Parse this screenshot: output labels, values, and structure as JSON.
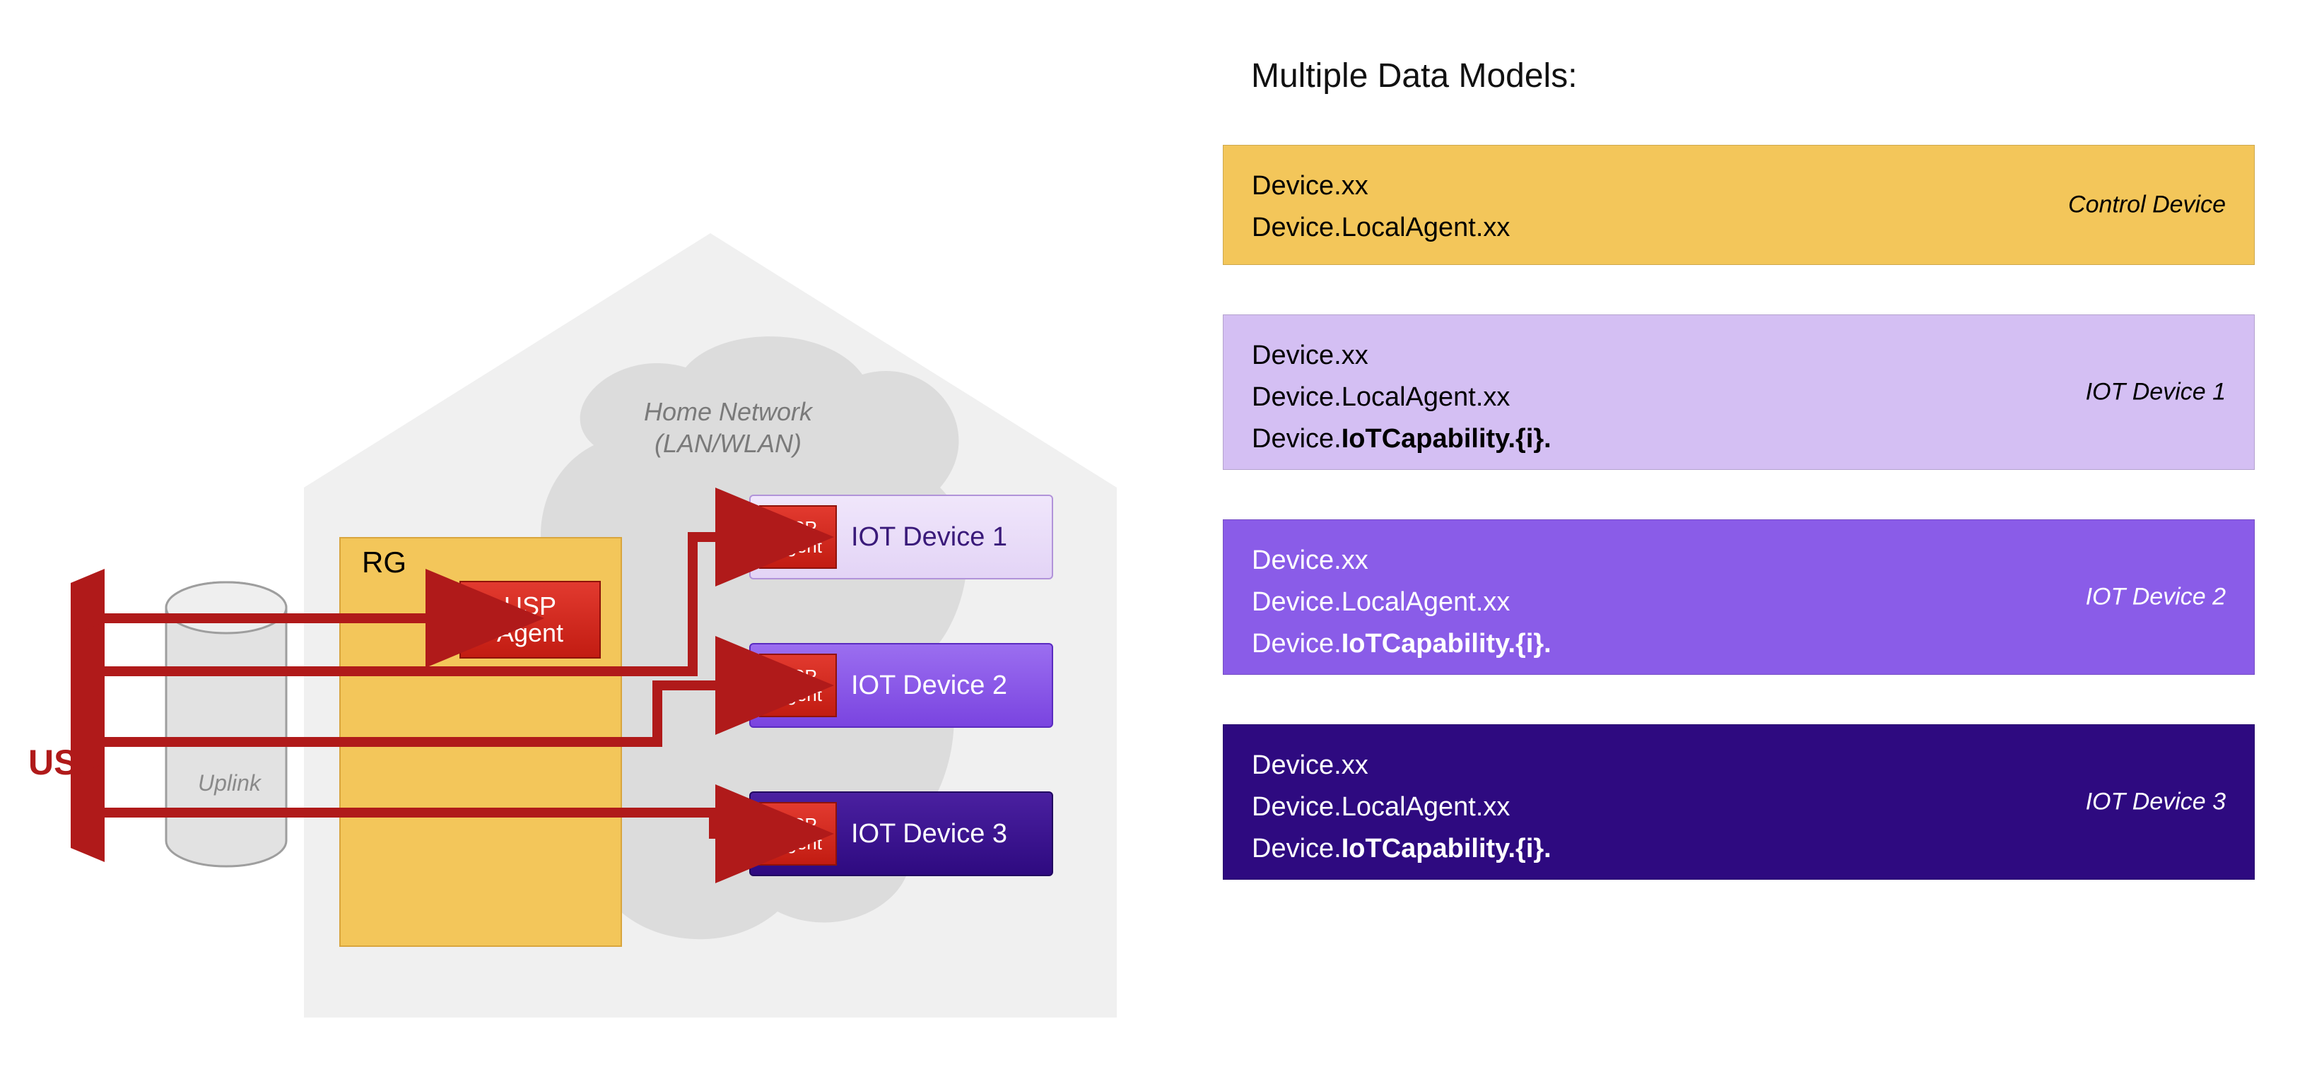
{
  "title": "Multiple Data Models:",
  "left": {
    "house_fill": "#f0f0f0",
    "cloud_fill": "#dcdcdc",
    "cloud_label_line1": "Home Network",
    "cloud_label_line2": "(LAN/WLAN)",
    "rg_label": "RG",
    "usp_agent_line1": "USP",
    "usp_agent_line2": "Agent",
    "uplink_label": "Uplink",
    "usp_label": "USP",
    "arrow_color": "#b01a1a",
    "iot_devices": [
      {
        "label": "IOT Device 1"
      },
      {
        "label": "IOT Device 2"
      },
      {
        "label": "IOT Device 3"
      }
    ]
  },
  "right": {
    "panels": [
      {
        "tag": "Control Device",
        "class": "dm-control",
        "lines": [
          {
            "prefix": "Device.xx",
            "bold": ""
          },
          {
            "prefix": "Device.LocalAgent.xx",
            "bold": ""
          }
        ]
      },
      {
        "tag": "IOT Device 1",
        "class": "dm-iot1",
        "lines": [
          {
            "prefix": "Device.xx",
            "bold": ""
          },
          {
            "prefix": "Device.LocalAgent.xx",
            "bold": ""
          },
          {
            "prefix": "Device.",
            "bold": "IoTCapability.{i}."
          }
        ]
      },
      {
        "tag": "IOT Device 2",
        "class": "dm-iot2",
        "lines": [
          {
            "prefix": "Device.xx",
            "bold": ""
          },
          {
            "prefix": "Device.LocalAgent.xx",
            "bold": ""
          },
          {
            "prefix": "Device.",
            "bold": "IoTCapability.{i}."
          }
        ]
      },
      {
        "tag": "IOT Device 3",
        "class": "dm-iot3",
        "lines": [
          {
            "prefix": "Device.xx",
            "bold": ""
          },
          {
            "prefix": "Device.LocalAgent.xx",
            "bold": ""
          },
          {
            "prefix": "Device.",
            "bold": "IoTCapability.{i}."
          }
        ]
      }
    ]
  }
}
